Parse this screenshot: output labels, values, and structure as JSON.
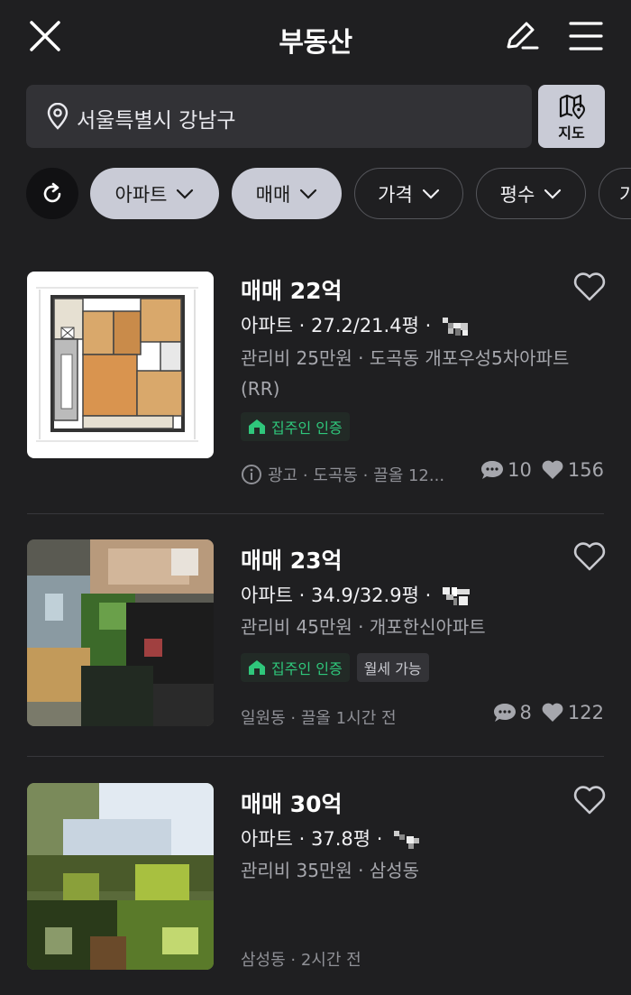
{
  "header": {
    "title": "부동산",
    "close_icon": "close-icon",
    "edit_icon": "edit-icon",
    "menu_icon": "menu-icon"
  },
  "search": {
    "value": "서울특별시 강남구",
    "icon": "location-pin-icon"
  },
  "map_button": {
    "label": "지도",
    "icon": "map-icon"
  },
  "filters": {
    "refresh_icon": "refresh-icon",
    "chips": [
      {
        "label": "아파트",
        "active": true
      },
      {
        "label": "매매",
        "active": true
      },
      {
        "label": "가격",
        "active": false
      },
      {
        "label": "평수",
        "active": false
      },
      {
        "label": "가",
        "active": false
      }
    ]
  },
  "listings": [
    {
      "title": "매매 22억",
      "line": "아파트 · 27.2/21.4평 ·",
      "sub": "관리비 25만원 · 도곡동 개포우성5차아파트(RR)",
      "badges": [
        {
          "label": "집주인 인증",
          "type": "green"
        }
      ],
      "meta": "광고 · 도곡동 · 끌올 12...",
      "comments": "10",
      "likes": "156"
    },
    {
      "title": "매매 23억",
      "line": "아파트 · 34.9/32.9평 ·",
      "sub": "관리비 45만원 · 개포한신아파트",
      "badges": [
        {
          "label": "집주인 인증",
          "type": "green"
        },
        {
          "label": "월세 가능",
          "type": "grey"
        }
      ],
      "meta": "일원동 · 끌올 1시간 전",
      "comments": "8",
      "likes": "122"
    },
    {
      "title": "매매 30억",
      "line": "아파트 · 37.8평 ·",
      "sub": "관리비 35만원 · 삼성동",
      "badges": [],
      "meta": "삼성동 · 2시간 전",
      "comments": "",
      "likes": ""
    }
  ]
}
